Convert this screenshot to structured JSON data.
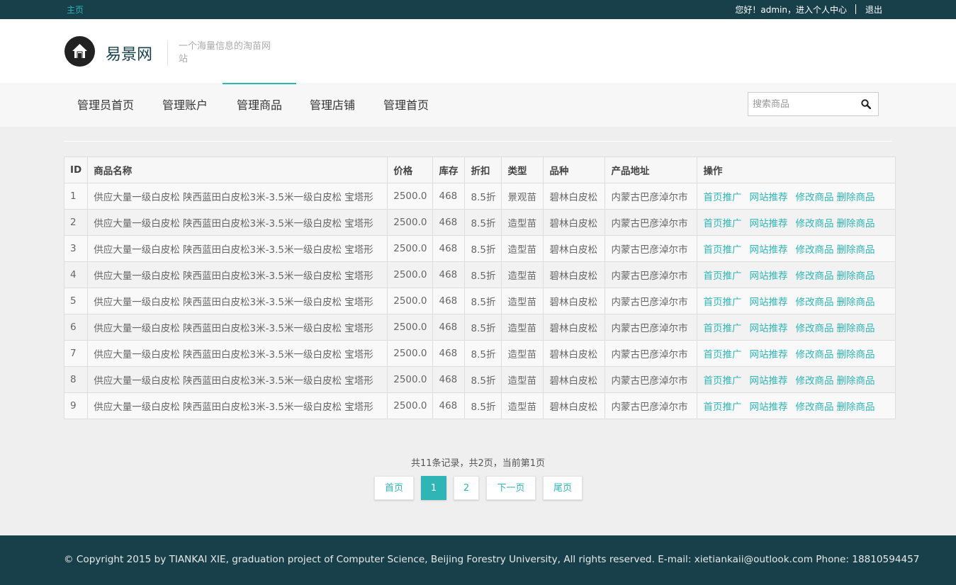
{
  "topbar": {
    "home": "主页",
    "greeting": "您好！admin，进入个人中心",
    "logout": "退出"
  },
  "brand": {
    "name": "易景网",
    "tagline": "一个海量信息的淘苗网站"
  },
  "nav": {
    "items": [
      "管理员首页",
      "管理账户",
      "管理商品",
      "管理店铺",
      "管理首页"
    ],
    "active_index": 2
  },
  "search": {
    "placeholder": "搜索商品",
    "value": ""
  },
  "table": {
    "headers": [
      "ID",
      "商品名称",
      "价格",
      "库存",
      "折扣",
      "类型",
      "品种",
      "产品地址",
      "操作"
    ],
    "actions": [
      "首页推广",
      "网站推荐",
      "修改商品",
      "删除商品"
    ],
    "rows": [
      [
        "1",
        "供应大量一级白皮松 陕西蓝田白皮松3米-3.5米一级白皮松 宝塔形",
        "2500.0",
        "468",
        "8.5折",
        "景观苗",
        "碧林白皮松",
        "内蒙古巴彦淖尔市"
      ],
      [
        "2",
        "供应大量一级白皮松 陕西蓝田白皮松3米-3.5米一级白皮松 宝塔形",
        "2500.0",
        "468",
        "8.5折",
        "造型苗",
        "碧林白皮松",
        "内蒙古巴彦淖尔市"
      ],
      [
        "3",
        "供应大量一级白皮松 陕西蓝田白皮松3米-3.5米一级白皮松 宝塔形",
        "2500.0",
        "468",
        "8.5折",
        "造型苗",
        "碧林白皮松",
        "内蒙古巴彦淖尔市"
      ],
      [
        "4",
        "供应大量一级白皮松 陕西蓝田白皮松3米-3.5米一级白皮松 宝塔形",
        "2500.0",
        "468",
        "8.5折",
        "造型苗",
        "碧林白皮松",
        "内蒙古巴彦淖尔市"
      ],
      [
        "5",
        "供应大量一级白皮松 陕西蓝田白皮松3米-3.5米一级白皮松 宝塔形",
        "2500.0",
        "468",
        "8.5折",
        "造型苗",
        "碧林白皮松",
        "内蒙古巴彦淖尔市"
      ],
      [
        "6",
        "供应大量一级白皮松 陕西蓝田白皮松3米-3.5米一级白皮松 宝塔形",
        "2500.0",
        "468",
        "8.5折",
        "造型苗",
        "碧林白皮松",
        "内蒙古巴彦淖尔市"
      ],
      [
        "7",
        "供应大量一级白皮松 陕西蓝田白皮松3米-3.5米一级白皮松 宝塔形",
        "2500.0",
        "468",
        "8.5折",
        "造型苗",
        "碧林白皮松",
        "内蒙古巴彦淖尔市"
      ],
      [
        "8",
        "供应大量一级白皮松 陕西蓝田白皮松3米-3.5米一级白皮松 宝塔形",
        "2500.0",
        "468",
        "8.5折",
        "造型苗",
        "碧林白皮松",
        "内蒙古巴彦淖尔市"
      ],
      [
        "9",
        "供应大量一级白皮松 陕西蓝田白皮松3米-3.5米一级白皮松 宝塔形",
        "2500.0",
        "468",
        "8.5折",
        "造型苗",
        "碧林白皮松",
        "内蒙古巴彦淖尔市"
      ]
    ]
  },
  "pagination": {
    "info": "共11条记录，共2页，当前第1页",
    "first": "首页",
    "pages": [
      "1",
      "2"
    ],
    "current": "1",
    "next": "下一页",
    "last": "尾页"
  },
  "footer": {
    "text": "© Copyright 2015 by TIANKAI XIE, graduation project of Computer Science, Beijing Forestry University, All rights reserved. E-mail: xietiankaii@outlook.com Phone: 18810594457"
  },
  "colors": {
    "accent": "#2fb5b5",
    "dark": "#17404a"
  },
  "icons": {
    "logo": "home-icon",
    "search": "search-icon"
  }
}
